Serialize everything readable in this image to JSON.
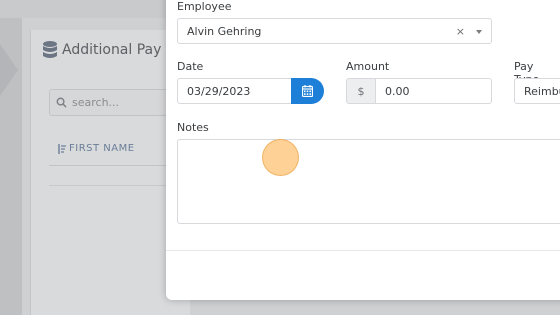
{
  "background": {
    "panel_title": "Additional Pay",
    "search_placeholder": "search...",
    "column_header": "FIRST NAME"
  },
  "modal": {
    "employee": {
      "label": "Employee",
      "value": "Alvin Gehring",
      "clear": "×"
    },
    "date": {
      "label": "Date",
      "value": "03/29/2023"
    },
    "amount": {
      "label": "Amount",
      "currency": "$",
      "value": "0.00"
    },
    "pay_type": {
      "label": "Pay Type",
      "value": "Reimbu"
    },
    "notes": {
      "label": "Notes",
      "value": ""
    }
  },
  "colors": {
    "accent": "#1e7fd8",
    "cursor_highlight": "#fdc273"
  },
  "icons": [
    "database-icon",
    "search-icon",
    "sort-icon",
    "calendar-icon",
    "chevron-down-icon"
  ]
}
